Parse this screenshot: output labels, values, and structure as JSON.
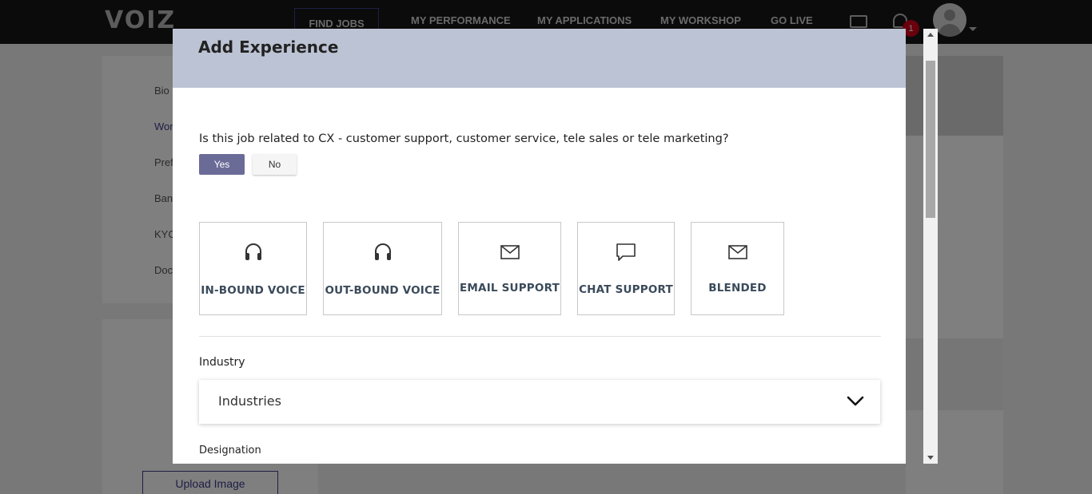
{
  "app": {
    "logo": "VOIZ"
  },
  "nav": {
    "items": [
      {
        "label": "FIND JOBS"
      },
      {
        "label": "MY PERFORMANCE"
      },
      {
        "label": "MY APPLICATIONS"
      },
      {
        "label": "MY WORKSHOP"
      },
      {
        "label": "GO LIVE"
      }
    ],
    "notification_count": "1",
    "icons": {
      "messages": "chat-bubble-icon",
      "notifications": "bell-icon",
      "profile": "user-avatar-icon"
    }
  },
  "sidebar": {
    "items": [
      {
        "label": "Bio"
      },
      {
        "label": "Wor"
      },
      {
        "label": "Pref"
      },
      {
        "label": "Bank"
      },
      {
        "label": "KYC"
      },
      {
        "label": "Doc"
      }
    ],
    "upload_label": "Upload Image"
  },
  "modal": {
    "title": "Add Experience",
    "question": "Is this job related to CX - customer support, customer service, tele sales or tele marketing?",
    "yes_label": "Yes",
    "no_label": "No",
    "selected": "Yes",
    "tiles": [
      {
        "label": "IN-BOUND VOICE",
        "icon": "headset-icon"
      },
      {
        "label": "OUT-BOUND VOICE",
        "icon": "headset-icon"
      },
      {
        "label": "EMAIL SUPPORT",
        "icon": "envelope-icon"
      },
      {
        "label": "CHAT SUPPORT",
        "icon": "chat-bubble-icon"
      },
      {
        "label": "BLENDED",
        "icon": "envelope-icon"
      }
    ],
    "industry_label": "Industry",
    "industry_placeholder": "Industries",
    "designation_label": "Designation"
  },
  "colors": {
    "accent": "#6b6b98",
    "header_bg": "#bcc3d4",
    "nav_bg": "#161616",
    "badge": "#d0021b"
  }
}
